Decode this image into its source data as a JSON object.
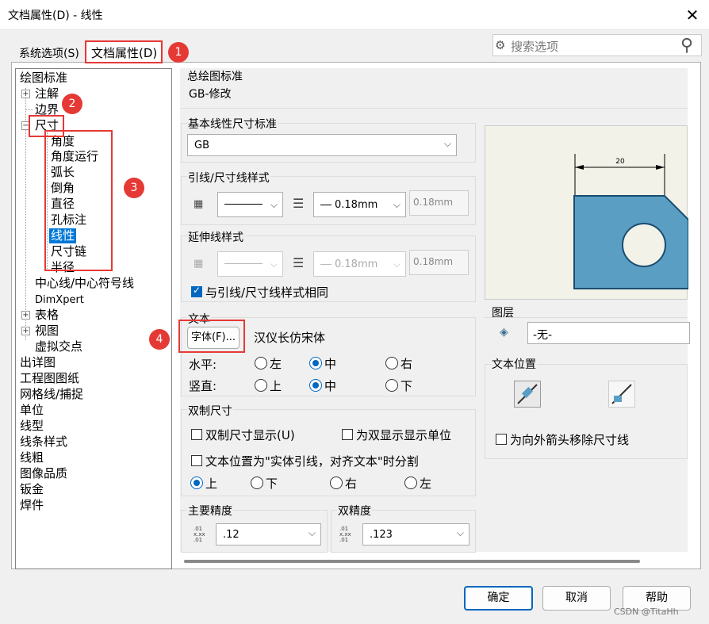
{
  "window": {
    "title": "文档属性(D) - 线性",
    "close_glyph": "✕"
  },
  "tabs": {
    "system_options": "系统选项(S)",
    "document_properties": "文档属性(D)"
  },
  "search": {
    "placeholder": "搜索选项"
  },
  "tree": {
    "items": [
      "绘图标准",
      "注解",
      "边界",
      "尺寸",
      "角度",
      "角度运行",
      "弧长",
      "倒角",
      "直径",
      "孔标注",
      "线性",
      "尺寸链",
      "半径",
      "中心线/中心符号线",
      "DimXpert",
      "表格",
      "视图",
      "虚拟交点",
      "出详图",
      "工程图图纸",
      "网格线/捕捉",
      "单位",
      "线型",
      "线条样式",
      "线粗",
      "图像品质",
      "钣金",
      "焊件"
    ],
    "selected": "线性"
  },
  "overall_standard": {
    "label": "总绘图标准",
    "value": "GB-修改"
  },
  "base_standard": {
    "label": "基本线性尺寸标准",
    "value": "GB"
  },
  "leader_style": {
    "label": "引线/尺寸线样式",
    "line_width": "0.18mm",
    "thickness_box": "0.18mm"
  },
  "extension_style": {
    "label": "延伸线样式",
    "line_width": "0.18mm",
    "thickness_box": "0.18mm",
    "same_as_leader_label": "与引线/尺寸线样式相同",
    "same_as_leader_checked": true
  },
  "text": {
    "label": "文本",
    "font_button": "字体(F)...",
    "font_name": "汉仪长仿宋体",
    "horizontal_label": "水平:",
    "vertical_label": "竖直:",
    "horizontal_options": [
      "左",
      "中",
      "右"
    ],
    "vertical_options": [
      "上",
      "中",
      "下"
    ],
    "horizontal_selected": "中",
    "vertical_selected": "中"
  },
  "dual_dimension": {
    "label": "双制尺寸",
    "show_dual": "双制尺寸显示(U)",
    "show_units": "为双显示显示单位",
    "split_when": "文本位置为\"实体引线，对齐文本\"时分割",
    "position_options": [
      "上",
      "下",
      "右",
      "左"
    ],
    "position_selected": "上"
  },
  "primary_precision": {
    "label": "主要精度",
    "value": ".12",
    "icon_text": ".01\nx.xx\n.01"
  },
  "dual_precision": {
    "label": "双精度",
    "value": ".123",
    "icon_text": ".01\nx.xx\n.01"
  },
  "preview": {
    "dimension_text": "20",
    "fill_color": "#5b9ec3"
  },
  "layer": {
    "label": "图层",
    "value": "-无-"
  },
  "text_position": {
    "label": "文本位置",
    "remove_dim_line": "为向外箭头移除尺寸线"
  },
  "buttons": {
    "ok": "确定",
    "cancel": "取消",
    "help": "帮助"
  },
  "annotations": [
    "1",
    "2",
    "3",
    "4"
  ],
  "watermark": "CSDN @TitaHh",
  "colors": {
    "accent": "#0067c0",
    "annotation_red": "#e53935",
    "selection": "#0078d7"
  }
}
